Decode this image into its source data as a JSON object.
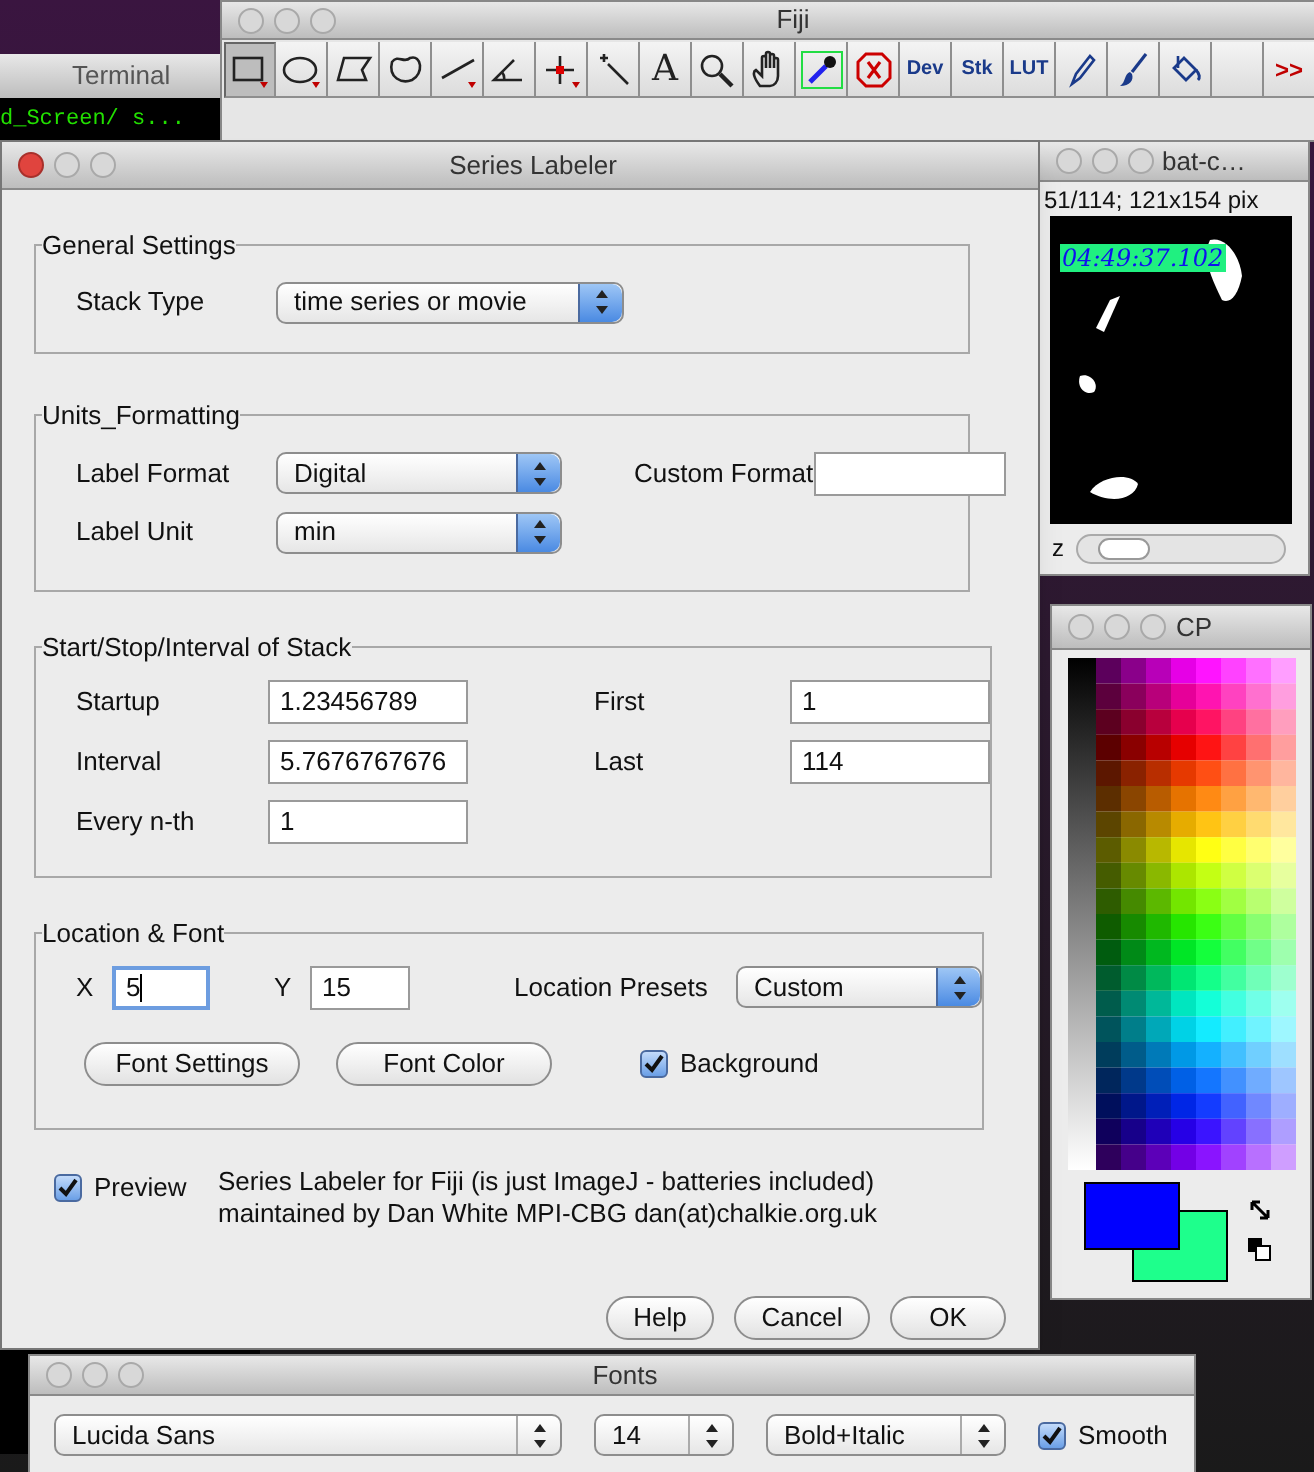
{
  "terminal": {
    "title": "Terminal",
    "lines": [
      "d_Screen/ s..."
    ]
  },
  "fiji": {
    "title": "Fiji",
    "tools": [
      {
        "kind": "rectangle",
        "selected": true
      },
      {
        "kind": "oval",
        "selected": false
      },
      {
        "kind": "polygon",
        "selected": false
      },
      {
        "kind": "freehand",
        "selected": false
      },
      {
        "kind": "line",
        "selected": false
      },
      {
        "kind": "angle",
        "selected": false
      },
      {
        "kind": "point",
        "selected": false
      },
      {
        "kind": "wand",
        "selected": false
      },
      {
        "kind": "text",
        "label": "A",
        "selected": false
      },
      {
        "kind": "magnifier",
        "selected": false
      },
      {
        "kind": "hand",
        "selected": false
      },
      {
        "kind": "dropper",
        "selected": false
      },
      {
        "kind": "stop",
        "selected": false
      },
      {
        "kind": "menu",
        "label": "Dev",
        "selected": false
      },
      {
        "kind": "menu",
        "label": "Stk",
        "selected": false
      },
      {
        "kind": "menu",
        "label": "LUT",
        "selected": false
      },
      {
        "kind": "pencil",
        "selected": false
      },
      {
        "kind": "brush",
        "selected": false
      },
      {
        "kind": "fill",
        "selected": false
      },
      {
        "kind": "blank",
        "selected": false
      },
      {
        "kind": "more",
        "label": ">>",
        "selected": false
      }
    ]
  },
  "series_labeler": {
    "title": "Series Labeler",
    "active": true,
    "general_settings": {
      "title": "General Settings",
      "stack_type": {
        "label": "Stack Type",
        "value": "time series or movie"
      }
    },
    "units_formatting": {
      "title": "Units_Formatting",
      "label_format": {
        "label": "Label Format",
        "value": "Digital"
      },
      "custom_format": {
        "label": "Custom Format"
      },
      "label_unit": {
        "label": "Label Unit",
        "value": "min"
      }
    },
    "stack_interval": {
      "title": "Start/Stop/Interval of Stack",
      "fields": [
        {
          "label": "Startup",
          "value": "1.23456789"
        },
        {
          "label": "First",
          "value": "1"
        },
        {
          "label": "Interval",
          "value": "5.7676767676"
        },
        {
          "label": "Last",
          "value": "114"
        },
        {
          "label": "Every n-th",
          "value": "1"
        }
      ]
    },
    "location_font": {
      "title": "Location & Font",
      "x": {
        "label": "X",
        "value": "5",
        "focused": true
      },
      "y": {
        "label": "Y",
        "value": "15",
        "focused": false
      },
      "location_presets": {
        "label": "Location Presets",
        "value": "Custom"
      },
      "buttons": [
        "Font Settings",
        "Font Color"
      ],
      "background": {
        "label": "Background",
        "checked": true
      }
    },
    "preview": {
      "label": "Preview",
      "checked": true
    },
    "info": [
      "Series Labeler for Fiji (is just ImageJ - batteries included)",
      "maintained by Dan White MPI-CBG dan(at)chalkie.org.uk"
    ],
    "buttons": [
      "Help",
      "Cancel",
      "OK"
    ]
  },
  "image_window": {
    "title": "bat-c…",
    "info": "51/114; 121x154 pix",
    "overlay_label": "04:49:37.102",
    "slider_label": "z"
  },
  "color_picker": {
    "title": "CP",
    "foreground": {
      "color": "#0000ff"
    },
    "background": {
      "color": "#1eff8c"
    }
  },
  "fonts": {
    "title": "Fonts",
    "font": "Lucida Sans",
    "size": "14",
    "style": "Bold+Italic",
    "smooth": {
      "label": "Smooth",
      "checked": true
    }
  }
}
